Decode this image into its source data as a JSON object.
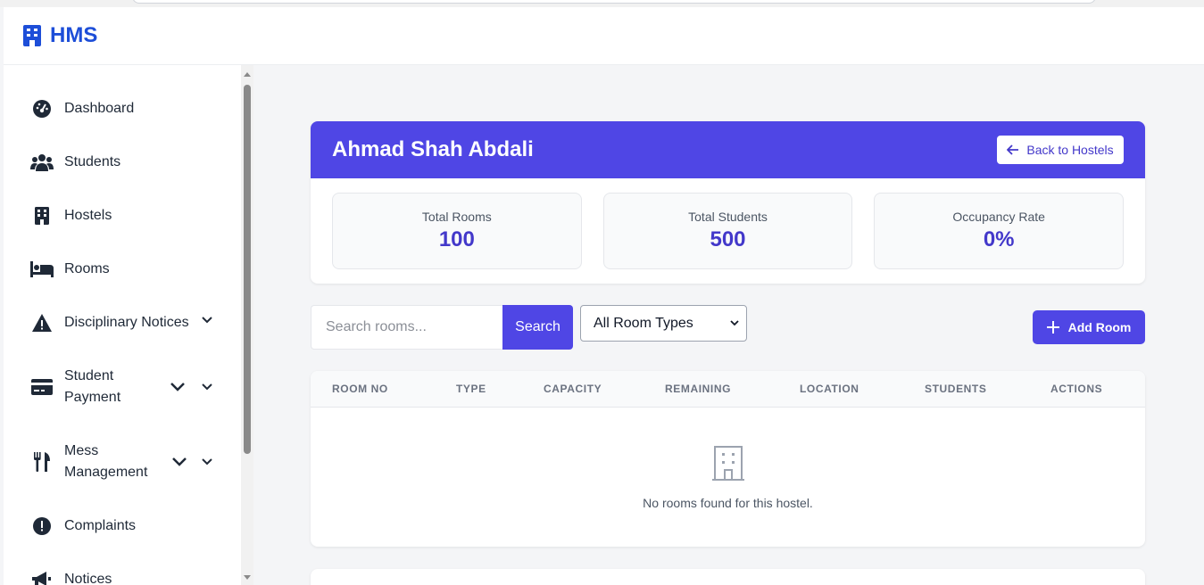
{
  "app": {
    "name": "HMS",
    "brand_color": "#1d4ed8",
    "accent": "#4f46e5"
  },
  "sidebar": {
    "items": [
      {
        "label": "Dashboard",
        "icon": "gauge-icon"
      },
      {
        "label": "Students",
        "icon": "users-icon"
      },
      {
        "label": "Hostels",
        "icon": "building-icon"
      },
      {
        "label": "Rooms",
        "icon": "bed-icon"
      },
      {
        "label": "Disciplinary Notices",
        "icon": "warning-icon"
      },
      {
        "label_line1": "Student",
        "label_line2": "Payment",
        "icon": "credit-card-icon"
      },
      {
        "label_line1": "Mess",
        "label_line2": "Management",
        "icon": "utensils-icon"
      },
      {
        "label": "Complaints",
        "icon": "exclamation-circle-icon"
      },
      {
        "label": "Notices",
        "icon": "megaphone-icon"
      }
    ]
  },
  "hostel": {
    "name": "Ahmad Shah Abdali",
    "back_label": "Back to Hostels",
    "stats": [
      {
        "label": "Total Rooms",
        "value": "100"
      },
      {
        "label": "Total Students",
        "value": "500"
      },
      {
        "label": "Occupancy Rate",
        "value": "0%"
      }
    ]
  },
  "toolbar": {
    "search_placeholder": "Search rooms...",
    "search_label": "Search",
    "room_type_selected": "All Room Types",
    "add_label": "Add Room"
  },
  "table": {
    "columns": [
      "ROOM NO",
      "TYPE",
      "CAPACITY",
      "REMAINING",
      "LOCATION",
      "STUDENTS",
      "ACTIONS"
    ],
    "empty_message": "No rooms found for this hostel."
  }
}
